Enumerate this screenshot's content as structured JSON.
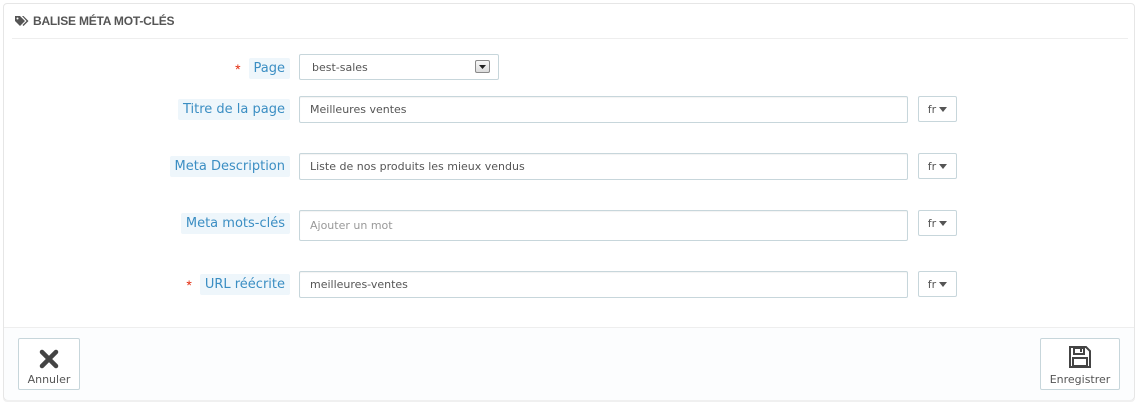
{
  "panel": {
    "title": "BALISE MÉTA MOT-CLÉS",
    "icon": "tags-icon"
  },
  "form": {
    "page": {
      "label": "Page",
      "required": true,
      "selected_value": "best-sales"
    },
    "title": {
      "label": "Titre de la page",
      "value": "Meilleures ventes",
      "lang": "fr"
    },
    "description": {
      "label": "Meta Description",
      "value": "Liste de nos produits les mieux vendus",
      "lang": "fr"
    },
    "keywords": {
      "label": "Meta mots-clés",
      "value": "",
      "placeholder": "Ajouter un mot",
      "lang": "fr"
    },
    "url": {
      "label": "URL réécrite",
      "required": true,
      "value": "meilleures-ventes",
      "lang": "fr"
    },
    "required_marker": "*"
  },
  "footer": {
    "cancel_label": "Annuler",
    "cancel_icon": "close-icon",
    "save_label": "Enregistrer",
    "save_icon": "save-icon"
  },
  "colors": {
    "label_text": "#3b8ec3",
    "label_bg": "#eef6fb",
    "required": "#e32b0e",
    "border": "#c7d6db"
  }
}
